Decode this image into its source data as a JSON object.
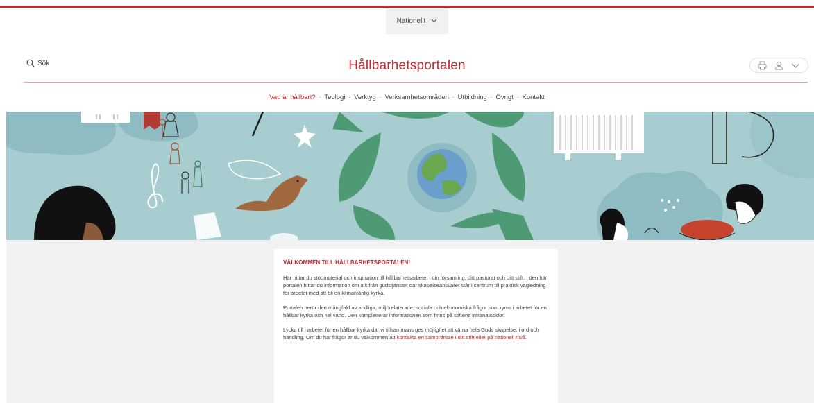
{
  "region": {
    "label": "Nationellt"
  },
  "header": {
    "search_label": "Sök",
    "site_title": "Hållbarhetsportalen"
  },
  "nav": {
    "items": [
      {
        "label": "Vad är hållbart?"
      },
      {
        "label": "Teologi"
      },
      {
        "label": "Verktyg"
      },
      {
        "label": "Verksamhetsområden"
      },
      {
        "label": "Utbildning"
      },
      {
        "label": "Övrigt"
      },
      {
        "label": "Kontakt"
      }
    ]
  },
  "welcome": {
    "heading": "VÄLKOMMEN TILL HÅLLBARHETSPORTALEN!",
    "para1": "Här hittar du stödmaterial och inspiration till hållbarhetsarbetet i din församling, ditt pastorat och ditt stift. I den här portalen hittar du information om allt från gudstjänster där skapelseansvaret står i centrum till praktisk vägledning för arbetet med att bli en klimatvänlig kyrka.",
    "para2": "Portalen berör den mångfald av andliga, miljörelaterade, sociala och ekonomiska frågor som ryms i arbetet för en hållbar kyrka och hel värld. Den kompletterar informationen som finns på stiftens intranätssidor.",
    "para3_text": "Lycka till i arbetet för en hållbar kyrka där vi tillsammans ges möjlighet att värna hela Guds skapelse,  i ord och handling. Om du har frågor är du välkommen att ",
    "para3_link": "kontakta en samordnare i ditt stift eller på nationell nivå."
  },
  "colors": {
    "accent": "#c0282d",
    "hero_bg": "#a8cdd1",
    "leaf_green": "#4e9a74",
    "page_bg": "#f2f2f2"
  },
  "icons": {
    "search": "search-icon",
    "region_chevron": "chevron-down-icon",
    "print": "print-icon",
    "user": "user-icon",
    "user_chevron": "chevron-down-icon"
  }
}
